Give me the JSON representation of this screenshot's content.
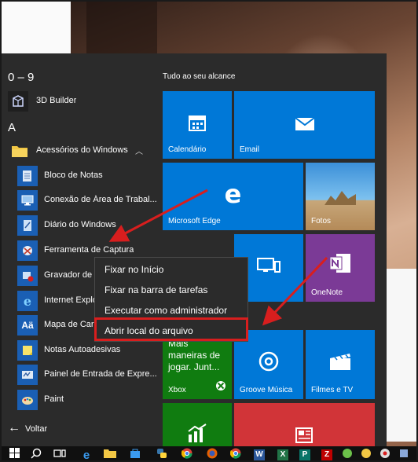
{
  "start_menu": {
    "sections": [
      {
        "letter": "0 – 9"
      },
      {
        "letter": "A"
      }
    ],
    "apps": [
      {
        "label": "3D Builder",
        "icon": "3d-builder-icon"
      },
      {
        "label": "Acessórios do Windows",
        "icon": "folder-icon",
        "expanded": true
      },
      {
        "label": "Bloco de Notas",
        "icon": "notepad-icon"
      },
      {
        "label": "Conexão de Área de Trabal...",
        "icon": "remote-desktop-icon"
      },
      {
        "label": "Diário do Windows",
        "icon": "journal-icon"
      },
      {
        "label": "Ferramenta de Captura",
        "icon": "snipping-tool-icon"
      },
      {
        "label": "Gravador de P",
        "icon": "steps-recorder-icon"
      },
      {
        "label": "Internet Explo",
        "icon": "internet-explorer-icon"
      },
      {
        "label": "Mapa de Cara",
        "icon": "character-map-icon"
      },
      {
        "label": "Notas Autoadesivas",
        "icon": "sticky-notes-icon"
      },
      {
        "label": "Painel de Entrada de Expre...",
        "icon": "math-input-icon"
      },
      {
        "label": "Paint",
        "icon": "paint-icon"
      }
    ],
    "back_label": "Voltar",
    "tiles_header": "Tudo ao seu alcance",
    "tiles": [
      {
        "label": "Calendário",
        "color": "#0078d7",
        "icon": "calendar-icon"
      },
      {
        "label": "Email",
        "color": "#0078d7",
        "icon": "mail-icon"
      },
      {
        "label": "Microsoft Edge",
        "color": "#0078d7",
        "icon": "edge-icon"
      },
      {
        "label": "Fotos",
        "color": "#1e88e5",
        "icon": "photos-icon"
      },
      {
        "label": "",
        "color": "#0078d7",
        "icon": "desktop-icon"
      },
      {
        "label": "OneNote",
        "color": "#7b3a96",
        "icon": "onenote-icon"
      },
      {
        "label": "Xbox",
        "color": "#107c10",
        "icon": "xbox-icon",
        "text": "Mais maneiras de jogar. Junt..."
      },
      {
        "label": "Groove Música",
        "color": "#0078d7",
        "icon": "groove-icon"
      },
      {
        "label": "Filmes e TV",
        "color": "#0078d7",
        "icon": "movies-icon"
      },
      {
        "label": "",
        "color": "#107c10",
        "icon": "money-icon"
      },
      {
        "label": "",
        "color": "#d13438",
        "icon": "news-icon"
      }
    ]
  },
  "context_menu": {
    "items": [
      {
        "label": "Fixar no Início"
      },
      {
        "label": "Fixar na barra de tarefas"
      },
      {
        "label": "Executar como administrador"
      },
      {
        "label": "Abrir local do arquivo",
        "highlighted": true
      }
    ]
  },
  "taskbar": {
    "items": [
      {
        "icon": "windows-start-icon"
      },
      {
        "icon": "search-icon"
      },
      {
        "icon": "task-view-icon"
      },
      {
        "icon": "edge-icon"
      },
      {
        "icon": "file-explorer-icon"
      },
      {
        "icon": "store-icon"
      },
      {
        "icon": "python-icon"
      },
      {
        "icon": "chrome-icon"
      },
      {
        "icon": "firefox-icon"
      },
      {
        "icon": "chrome-icon"
      },
      {
        "icon": "word-icon"
      },
      {
        "icon": "excel-icon"
      },
      {
        "icon": "publisher-icon"
      },
      {
        "icon": "filezilla-icon"
      },
      {
        "icon": "app-icon"
      },
      {
        "icon": "app-icon"
      },
      {
        "icon": "app-icon"
      },
      {
        "icon": "app-icon"
      },
      {
        "icon": "app-icon"
      }
    ]
  },
  "colors": {
    "annotation_red": "#d81e1e",
    "menu_bg": "#2b2b2b",
    "tile_blue": "#0078d7"
  }
}
